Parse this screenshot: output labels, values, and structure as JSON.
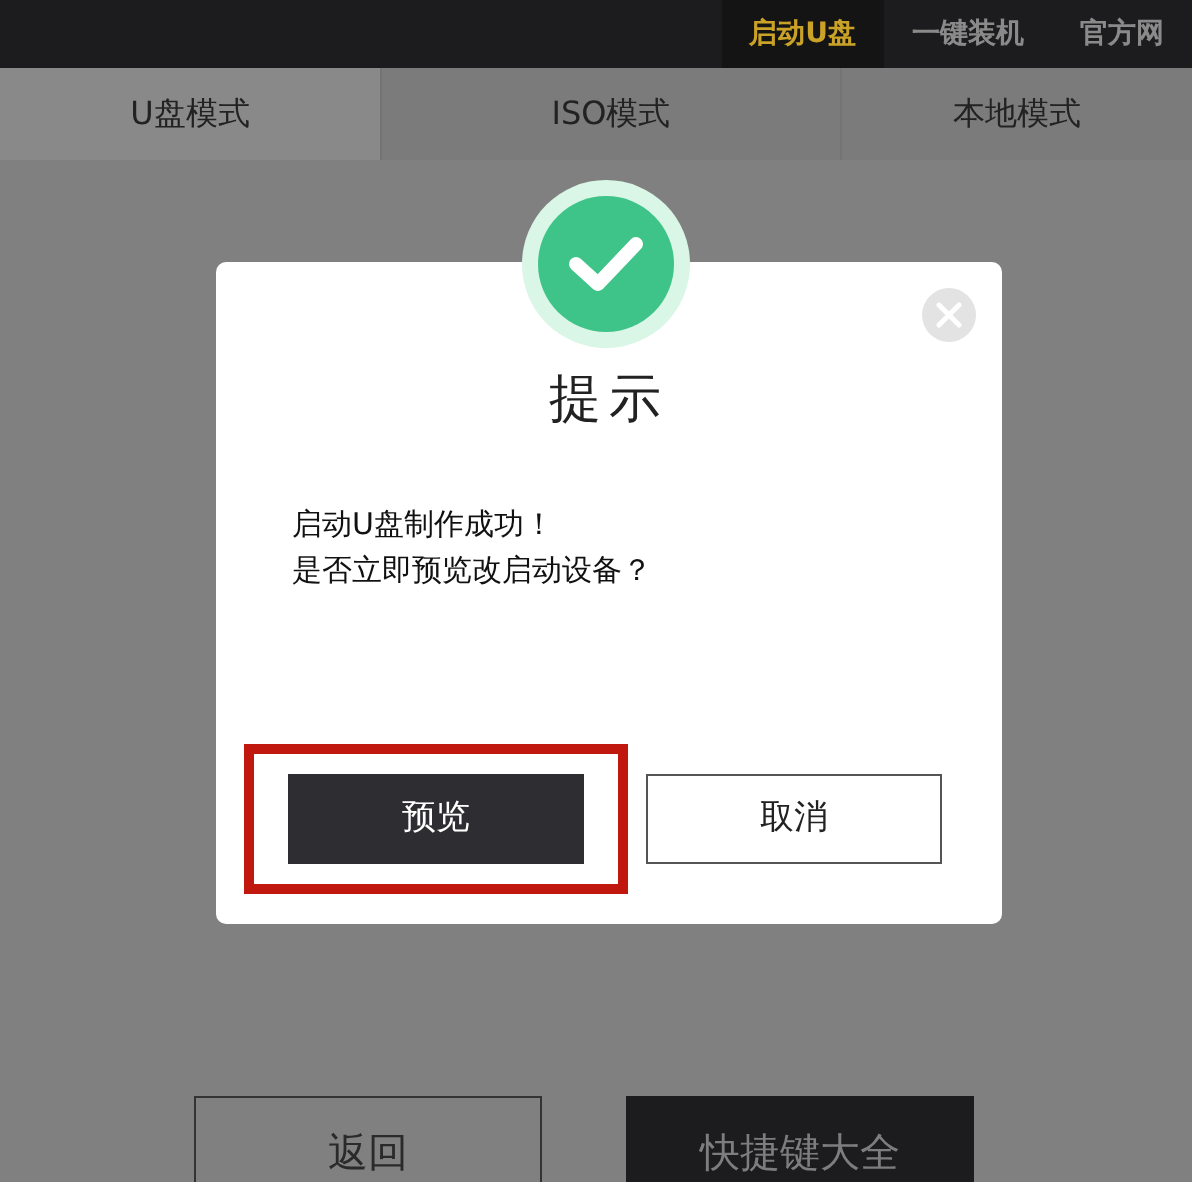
{
  "nav": [
    {
      "label": "启动U盘",
      "selected": true
    },
    {
      "label": "一键装机",
      "selected": false
    },
    {
      "label": "官方网",
      "selected": false
    }
  ],
  "tabs": [
    {
      "label": "U盘模式",
      "selected": true
    },
    {
      "label": "ISO模式",
      "selected": false
    },
    {
      "label": "本地模式",
      "selected": false
    }
  ],
  "bottom_buttons": [
    {
      "label": "返回",
      "kind": "outline"
    },
    {
      "label": "快捷键大全",
      "kind": "filled"
    }
  ],
  "dialog": {
    "title": "提示",
    "message": [
      "启动U盘制作成功！",
      "是否立即预览改启动设备？"
    ],
    "buttons": [
      {
        "label": "预览",
        "kind": "primary",
        "highlighted": true
      },
      {
        "label": "取消",
        "kind": "secondary",
        "highlighted": false
      }
    ]
  }
}
